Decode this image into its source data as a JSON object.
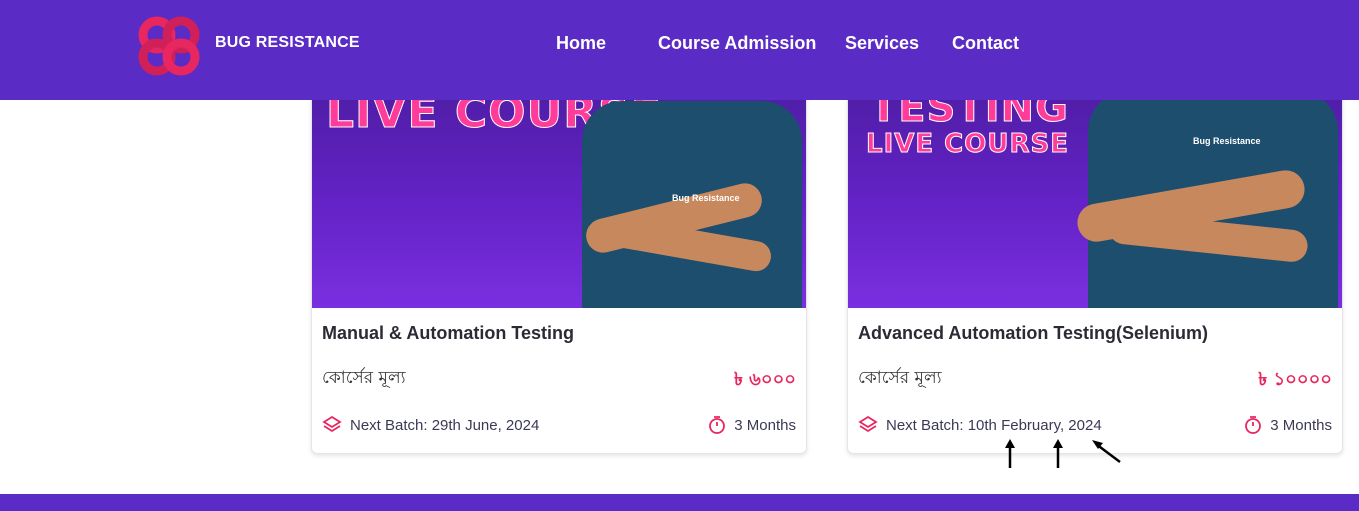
{
  "header": {
    "brand": "BUG RESISTANCE",
    "nav": [
      "Home",
      "Course Admission",
      "Services",
      "Contact"
    ]
  },
  "cards": [
    {
      "banner_line": "LIVE COURSE",
      "badge": "Bug Resistance",
      "title": "Manual & Automation Testing",
      "price_label": "কোর্সের মূল্য",
      "price": "৳ ৬০০০",
      "batch": "Next Batch: 29th June, 2024",
      "duration": "3 Months"
    },
    {
      "banner_line_top": "TESTING",
      "banner_line": "LIVE COURSE",
      "badge": "Bug Resistance",
      "title": "Advanced Automation Testing(Selenium)",
      "price_label": "কোর্সের মূল্য",
      "price": "৳ ১০০০০",
      "batch": "Next Batch: 10th February, 2024",
      "duration": "3 Months"
    }
  ],
  "colors": {
    "header": "#5b2bc6",
    "accent": "#e8265f",
    "text": "#2b2b35"
  },
  "icons": [
    "logo-icon",
    "layers-icon",
    "stopwatch-icon",
    "arrow-annotation-icon"
  ]
}
